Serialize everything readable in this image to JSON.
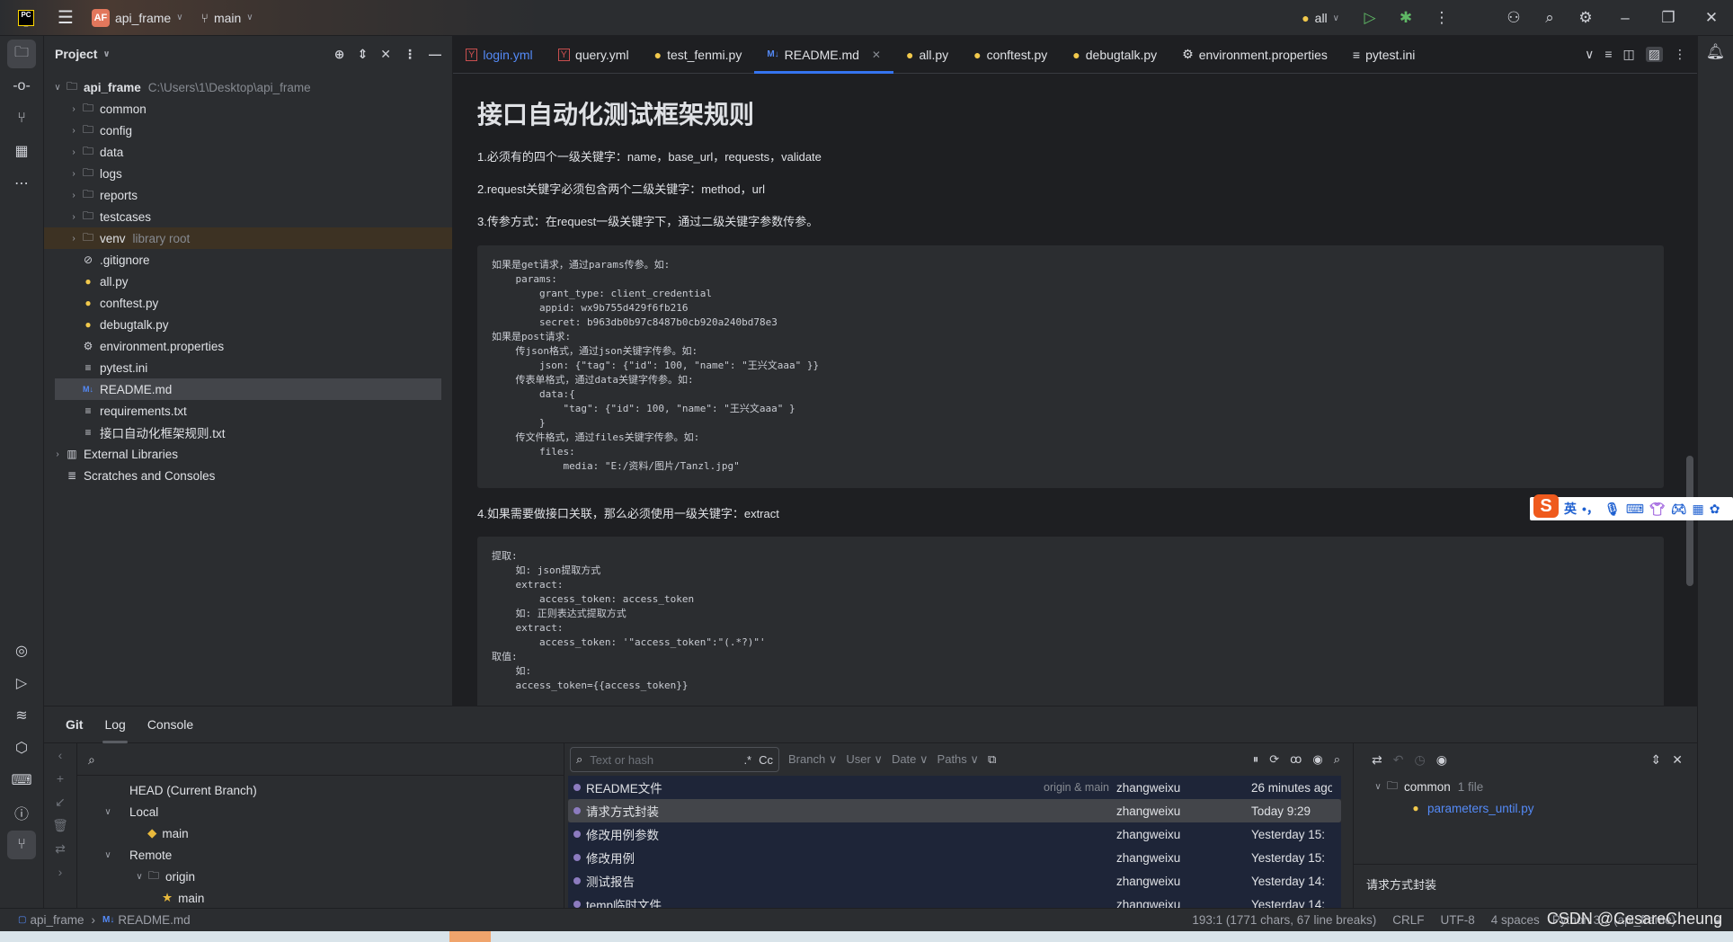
{
  "titlebar": {
    "project_badge": "AF",
    "project": "api_frame",
    "branch": "main",
    "run_config": "all"
  },
  "project_panel": {
    "title": "Project",
    "root": {
      "name": "api_frame",
      "path": "C:\\Users\\1\\Desktop\\api_frame"
    },
    "folders": [
      "common",
      "config",
      "data",
      "logs",
      "reports",
      "testcases"
    ],
    "venv": {
      "name": "venv",
      "note": "library root"
    },
    "files": [
      ".gitignore",
      "all.py",
      "conftest.py",
      "debugtalk.py",
      "environment.properties",
      "pytest.ini",
      "README.md",
      "requirements.txt",
      "接口自动化框架规则.txt"
    ],
    "external": "External Libraries",
    "scratches": "Scratches and Consoles"
  },
  "tabs": [
    "login.yml",
    "query.yml",
    "test_fenmi.py",
    "README.md",
    "all.py",
    "conftest.py",
    "debugtalk.py",
    "environment.properties",
    "pytest.ini"
  ],
  "active_tab": "README.md",
  "editor": {
    "h1": "接口自动化测试框架规则",
    "p1": "1.必须有的四个一级关键字：name，base_url，requests，validate",
    "p2": "2.request关键字必须包含两个二级关键字：method，url",
    "p3": "3.传参方式：在request一级关键字下，通过二级关键字参数传参。",
    "code1": "如果是get请求，通过params传参。如:\n    params:\n        grant_type: client_credential\n        appid: wx9b755d429f6fb216\n        secret: b963db0b97c8487b0cb920a240bd78e3\n如果是post请求:\n    传json格式，通过json关键字传参。如:\n        json: {\"tag\": {\"id\": 100, \"name\": \"王兴文aaa\" }}\n    传表单格式，通过data关键字传参。如:\n        data:{\n            \"tag\": {\"id\": 100, \"name\": \"王兴文aaa\" }\n        }\n    传文件格式，通过files关键字传参。如:\n        files:\n            media: \"E:/资料/图片/Tanzl.jpg\"",
    "p4": "4.如果需要做接口关联，那么必须使用一级关键字：extract",
    "code2": "提取:\n    如: json提取方式\n    extract:\n        access_token: access_token\n    如: 正则表达式提取方式\n    extract:\n        access_token: '\"access_token\":\"(.*?)\"'\n取值:\n    如:\n    access_token={{access_token}}"
  },
  "ime": {
    "logo": "S",
    "lang": "英",
    "punct": "•，"
  },
  "toolwindow": {
    "tabs": [
      "Git",
      "Log",
      "Console"
    ],
    "active": "Log",
    "branches": {
      "head": "HEAD (Current Branch)",
      "local": "Local",
      "local_main": "main",
      "remote": "Remote",
      "origin": "origin",
      "origin_main": "main"
    },
    "log": {
      "search_placeholder": "Text or hash",
      "regex": ".*",
      "case": "Cc",
      "filters": [
        "Branch",
        "User",
        "Date",
        "Paths"
      ],
      "rows": [
        {
          "msg": "README文件",
          "refs": "origin & main",
          "author": "zhangweixu",
          "date": "26 minutes ago"
        },
        {
          "msg": "请求方式封装",
          "refs": "",
          "author": "zhangweixu",
          "date": "Today 9:29"
        },
        {
          "msg": "修改用例参数",
          "refs": "",
          "author": "zhangweixu",
          "date": "Yesterday 15:"
        },
        {
          "msg": "修改用例",
          "refs": "",
          "author": "zhangweixu",
          "date": "Yesterday 15:"
        },
        {
          "msg": "测试报告",
          "refs": "",
          "author": "zhangweixu",
          "date": "Yesterday 14:"
        },
        {
          "msg": "temp临时文件",
          "refs": "",
          "author": "zhangweixu",
          "date": "Yesterday 14:"
        }
      ]
    },
    "changes": {
      "folder": "common",
      "count": "1 file",
      "file": "parameters_until.py",
      "commit_msg": "请求方式封装"
    }
  },
  "status": {
    "project": "api_frame",
    "file": "README.md",
    "position": "193:1 (1771 chars, 67 line breaks)",
    "line_sep": "CRLF",
    "encoding": "UTF-8",
    "indent": "4 spaces",
    "interpreter": "Python 3.7 (api_frame)",
    "watermark": "CSDN @CesareCheung"
  }
}
